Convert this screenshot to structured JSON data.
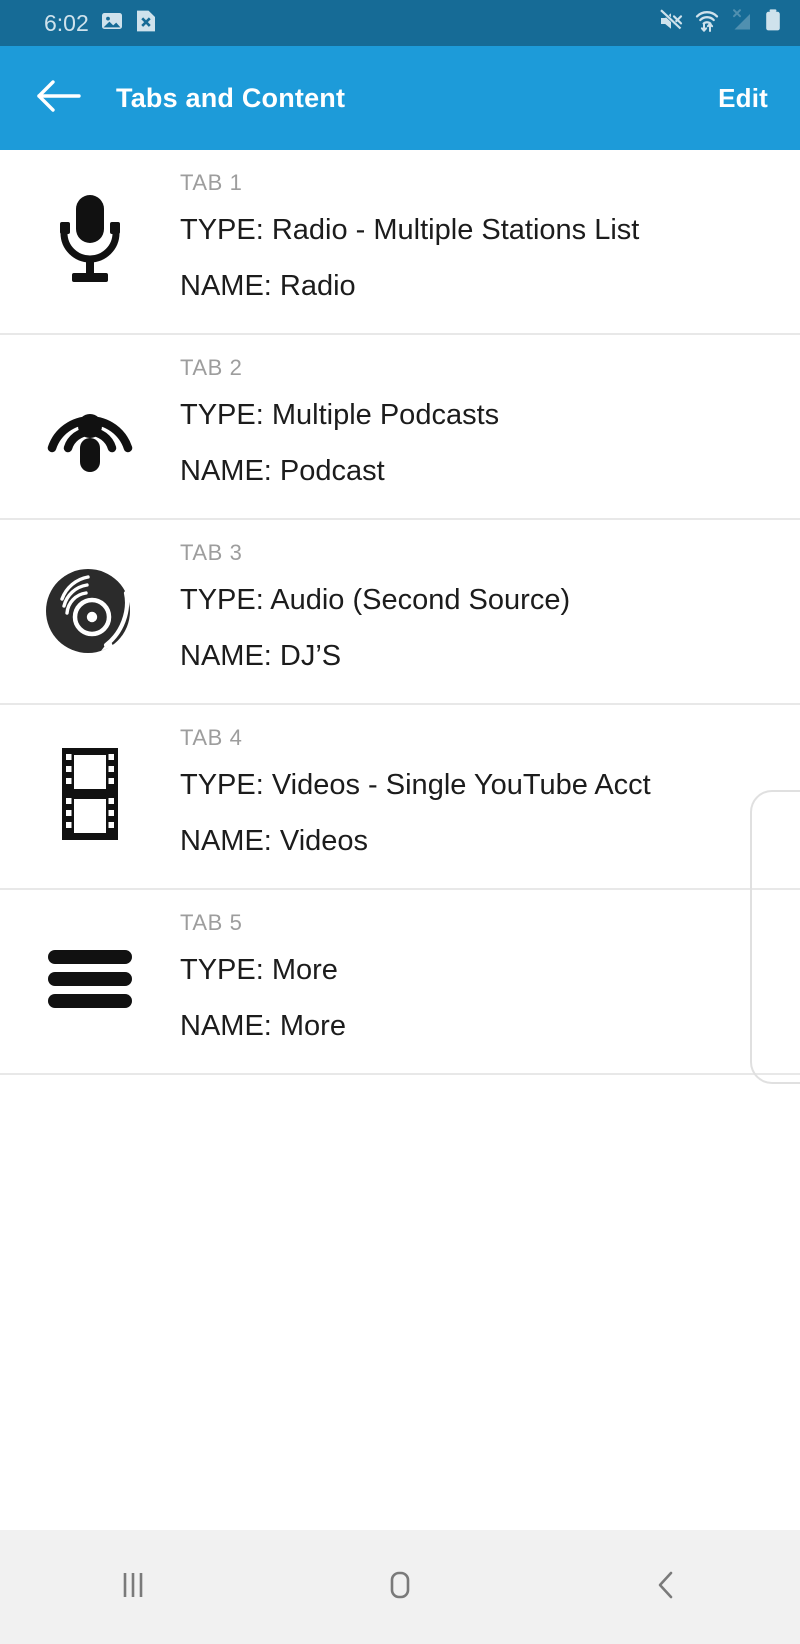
{
  "status_bar": {
    "time": "6:02",
    "left_icons": [
      {
        "name": "image-icon"
      },
      {
        "name": "file-x-icon"
      }
    ],
    "right_icons": [
      {
        "name": "mute-icon"
      },
      {
        "name": "wifi-data-icon"
      },
      {
        "name": "no-signal-icon"
      },
      {
        "name": "battery-icon"
      }
    ],
    "background_color": "#166b96",
    "foreground_color": "#cfe2ec"
  },
  "app_bar": {
    "title": "Tabs and Content",
    "back_icon": "arrow-left-icon",
    "edit_label": "Edit",
    "background_color": "#1d9bd9",
    "text_color": "#ffffff"
  },
  "list": {
    "type_prefix": "TYPE:",
    "name_prefix": "NAME:",
    "items": [
      {
        "tab_label": "TAB 1",
        "icon": "microphone-icon",
        "type_line": "TYPE: Radio - Multiple Stations List",
        "name_line": "NAME: Radio",
        "type_value": "Radio - Multiple Stations List",
        "name_value": "Radio"
      },
      {
        "tab_label": "TAB 2",
        "icon": "podcast-icon",
        "type_line": "TYPE: Multiple Podcasts",
        "name_line": "NAME: Podcast",
        "type_value": "Multiple Podcasts",
        "name_value": "Podcast"
      },
      {
        "tab_label": "TAB 3",
        "icon": "vinyl-record-icon",
        "type_line": "TYPE: Audio (Second Source)",
        "name_line": "NAME: DJ’S",
        "type_value": "Audio (Second Source)",
        "name_value": "DJ’S"
      },
      {
        "tab_label": "TAB 4",
        "icon": "filmstrip-icon",
        "type_line": "TYPE: Videos - Single YouTube Acct",
        "name_line": "NAME: Videos",
        "type_value": "Videos - Single YouTube Acct",
        "name_value": "Videos"
      },
      {
        "tab_label": "TAB 5",
        "icon": "hamburger-menu-icon",
        "type_line": "TYPE: More",
        "name_line": "NAME: More",
        "type_value": "More",
        "name_value": "More"
      }
    ],
    "divider_color": "#e8e8e8",
    "tab_label_color": "#9d9d9d",
    "text_color": "#1c1c1c"
  },
  "nav_bar": {
    "background_color": "#f1f1f1",
    "icon_color": "#7a7a7a",
    "buttons": [
      {
        "name": "recents-icon"
      },
      {
        "name": "home-icon"
      },
      {
        "name": "back-icon"
      }
    ]
  }
}
